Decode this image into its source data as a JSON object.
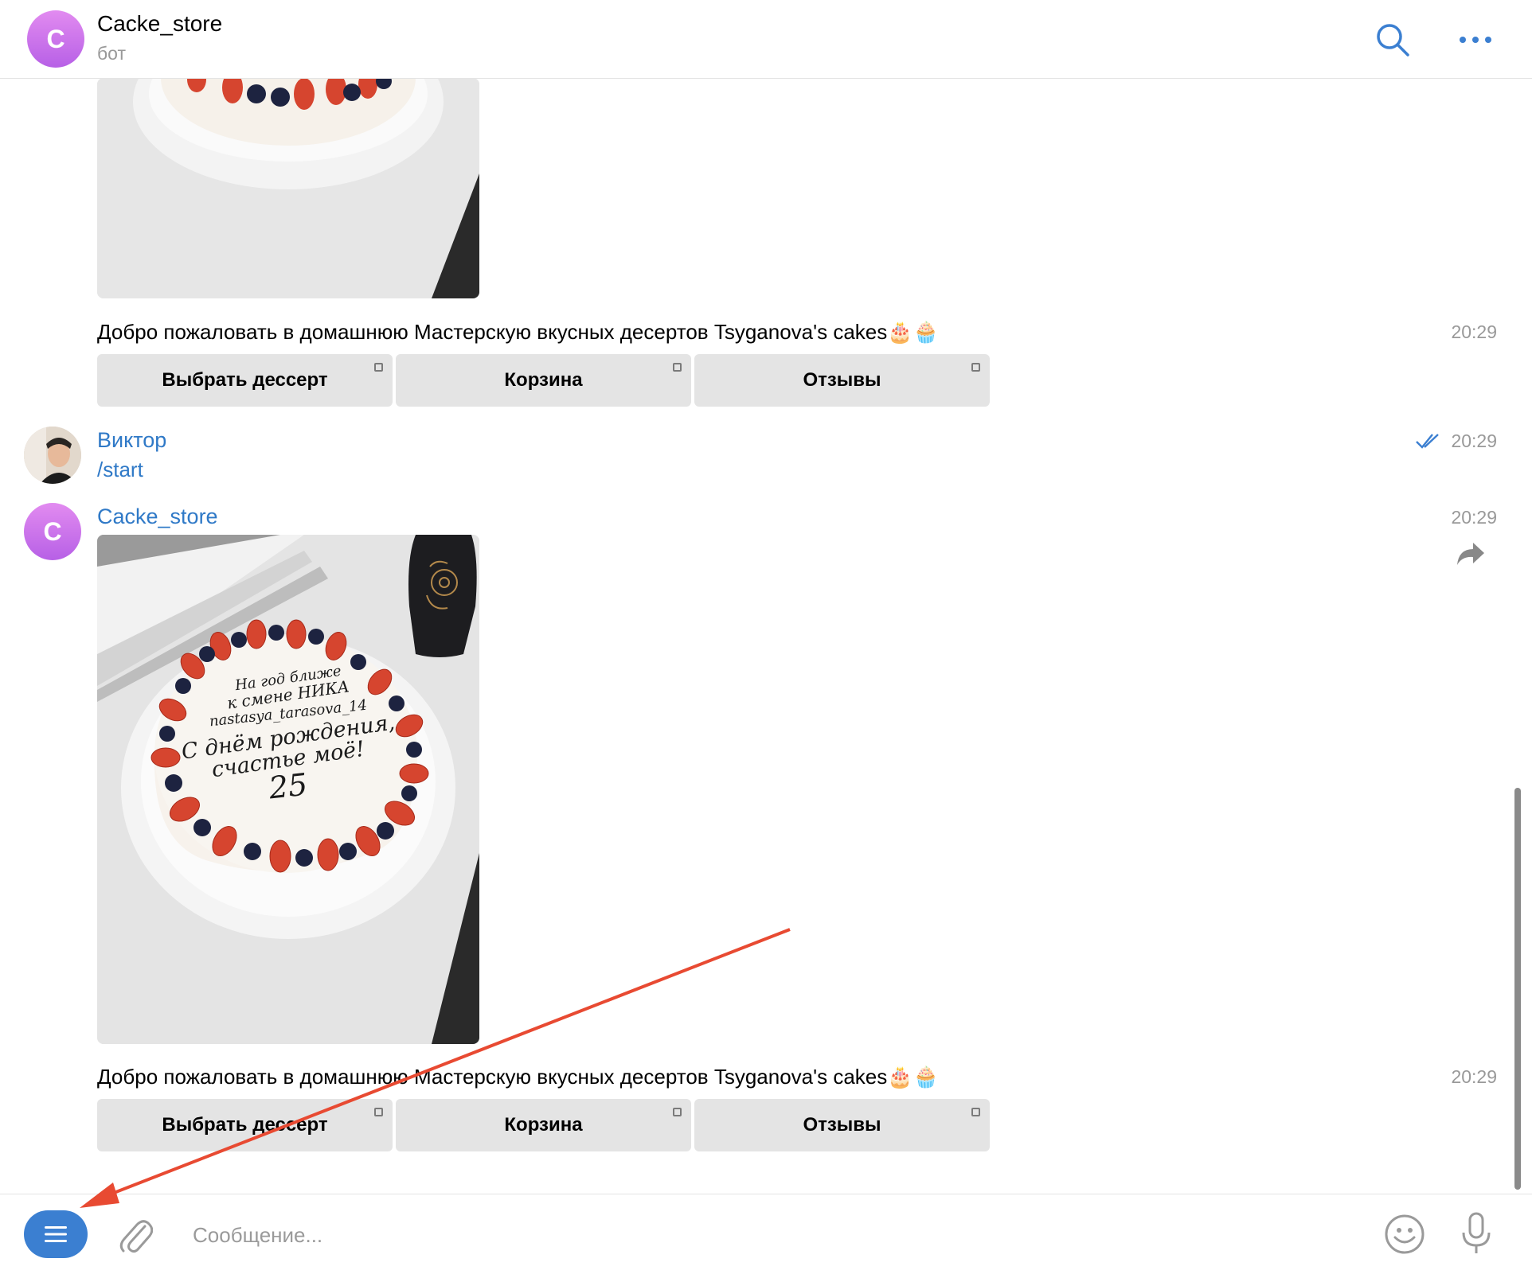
{
  "header": {
    "avatar_letter": "C",
    "title": "Cacke_store",
    "subtitle": "бот",
    "search_icon": "search-icon",
    "more_icon": "more-icon"
  },
  "messages": [
    {
      "type": "bot_photo_message",
      "text": "Добро пожаловать в домашнюю Мастерскую вкусных десертов Tsyganova's cakes🎂🧁",
      "time": "20:29",
      "buttons": [
        "Выбрать дессерт",
        "Корзина",
        "Отзывы"
      ]
    },
    {
      "type": "user_message",
      "sender": "Виктор",
      "text": "/start",
      "time": "20:29",
      "status_icon": "double-check-icon"
    },
    {
      "type": "bot_photo_message",
      "sender": "Cacke_store",
      "avatar_letter": "C",
      "sender_time": "20:29",
      "photo_inscription": [
        "На год ближе",
        "к смене НИКА",
        "nastasya_tarasova_14",
        "С днём рождения,",
        "счастье моё!",
        "25"
      ],
      "text": "Добро пожаловать в домашнюю Мастерскую вкусных десертов Tsyganova's cakes🎂🧁",
      "time": "20:29",
      "buttons": [
        "Выбрать дессерт",
        "Корзина",
        "Отзывы"
      ]
    }
  ],
  "composer": {
    "placeholder": "Сообщение...",
    "menu_icon": "menu-icon",
    "attach_icon": "paperclip-icon",
    "emoji_icon": "smile-icon",
    "mic_icon": "microphone-icon"
  },
  "colors": {
    "accent": "#3b7fd1",
    "link": "#2f79c7",
    "avatar_gradient_top": "#e28bf0",
    "avatar_gradient_bottom": "#b760e6",
    "annotation_arrow": "#e84a32"
  }
}
